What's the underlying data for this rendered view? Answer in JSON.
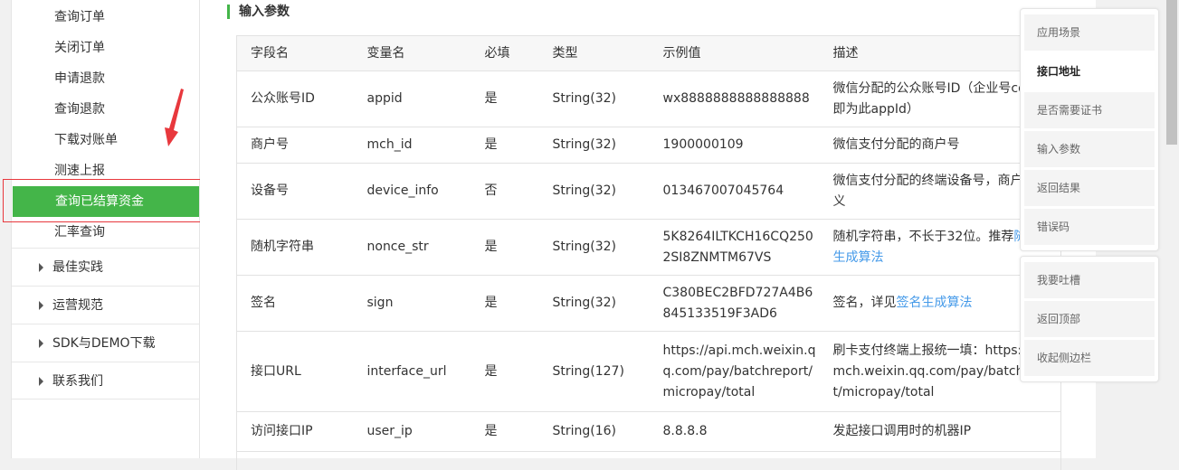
{
  "sidebar": {
    "sub_items": [
      {
        "label": "查询订单"
      },
      {
        "label": "关闭订单"
      },
      {
        "label": "申请退款"
      },
      {
        "label": "查询退款"
      },
      {
        "label": "下载对账单"
      },
      {
        "label": "测速上报"
      },
      {
        "label": "查询已结算资金",
        "active": true
      },
      {
        "label": "汇率查询"
      }
    ],
    "groups": [
      {
        "label": "最佳实践"
      },
      {
        "label": "运营规范"
      },
      {
        "label": "SDK与DEMO下载"
      },
      {
        "label": "联系我们"
      }
    ]
  },
  "main": {
    "section_title": "输入参数",
    "table": {
      "headers": [
        "字段名",
        "变量名",
        "必填",
        "类型",
        "示例值",
        "描述"
      ],
      "rows": [
        {
          "field": "公众账号ID",
          "var": "appid",
          "required": "是",
          "type": "String(32)",
          "example": "wx8888888888888888",
          "desc": "微信分配的公众账号ID（企业号corpid即为此appId）",
          "link": ""
        },
        {
          "field": "商户号",
          "var": "mch_id",
          "required": "是",
          "type": "String(32)",
          "example": "1900000109",
          "desc": "微信支付分配的商户号",
          "link": ""
        },
        {
          "field": "设备号",
          "var": "device_info",
          "required": "否",
          "type": "String(32)",
          "example": "013467007045764",
          "desc": "微信支付分配的终端设备号，商户自定义",
          "link": ""
        },
        {
          "field": "随机字符串",
          "var": "nonce_str",
          "required": "是",
          "type": "String(32)",
          "example": "5K8264ILTKCH16CQ2502SI8ZNMTM67VS",
          "desc": "随机字符串，不长于32位。推荐",
          "link": "随机数生成算法"
        },
        {
          "field": "签名",
          "var": "sign",
          "required": "是",
          "type": "String(32)",
          "example": "C380BEC2BFD727A4B6845133519F3AD6",
          "desc": "签名，详见",
          "link": "签名生成算法"
        },
        {
          "field": "接口URL",
          "var": "interface_url",
          "required": "是",
          "type": "String(127)",
          "example": "https://api.mch.weixin.qq.com/pay/batchreport/micropay/total",
          "desc": "刷卡支付终端上报统一填：https://api.mch.weixin.qq.com/pay/batchreport/micropay/total",
          "link": ""
        },
        {
          "field": "访问接口IP",
          "var": "user_ip",
          "required": "是",
          "type": "String(16)",
          "example": "8.8.8.8",
          "desc": "发起接口调用时的机器IP",
          "link": ""
        }
      ]
    }
  },
  "float_nav": {
    "items": [
      {
        "label": "应用场景"
      },
      {
        "label": "接口地址",
        "current": true
      },
      {
        "label": "是否需要证书"
      },
      {
        "label": "输入参数"
      },
      {
        "label": "返回结果"
      },
      {
        "label": "错误码"
      }
    ],
    "tools": [
      {
        "label": "我要吐槽"
      },
      {
        "label": "返回顶部"
      },
      {
        "label": "收起侧边栏"
      }
    ]
  },
  "colors": {
    "accent": "#44b549",
    "annotation": "#e8383d",
    "link": "#459ae9"
  },
  "icons": {
    "group_toggle": "caret-right-icon",
    "annotation": "red-arrow-icon"
  }
}
